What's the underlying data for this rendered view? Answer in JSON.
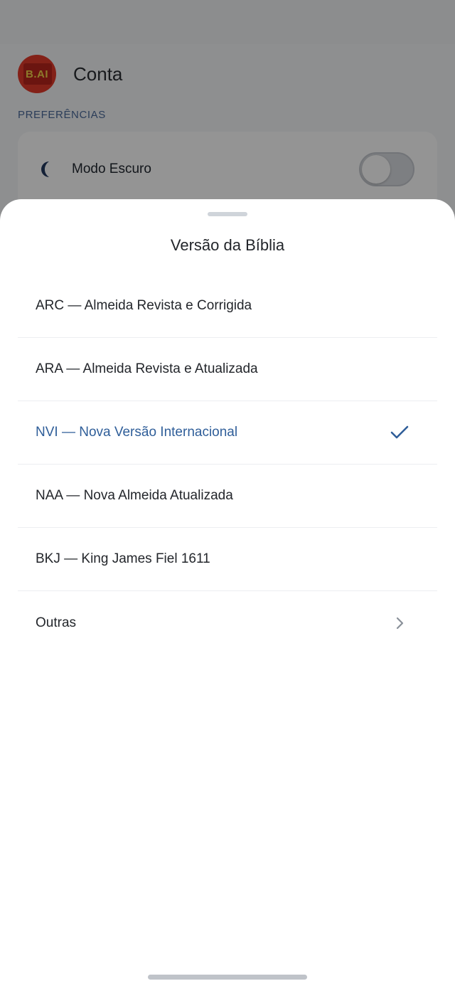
{
  "background": {
    "account_title": "Conta",
    "logo_text": "B.AI",
    "section_label": "PREFERÊNCIAS",
    "dark_mode_label": "Modo Escuro",
    "dark_mode_on": false
  },
  "sheet": {
    "title": "Versão da Bíblia",
    "versions": [
      {
        "label": "ARC — Almeida Revista e Corrigida",
        "selected": false
      },
      {
        "label": "ARA — Almeida Revista e Atualizada",
        "selected": false
      },
      {
        "label": "NVI — Nova Versão Internacional",
        "selected": true
      },
      {
        "label": "NAA — Nova Almeida Atualizada",
        "selected": false
      },
      {
        "label": "BKJ — King James Fiel 1611",
        "selected": false
      },
      {
        "label": "Outras",
        "selected": false
      }
    ]
  },
  "colors": {
    "accent": "#2f5e99",
    "section_label": "#4a6a9a",
    "logo_red": "#e23a2a",
    "logo_gold": "#f3d34a"
  },
  "icons": {
    "moon": "moon-icon",
    "check": "check-icon",
    "chevron": "chevron-right-icon"
  }
}
